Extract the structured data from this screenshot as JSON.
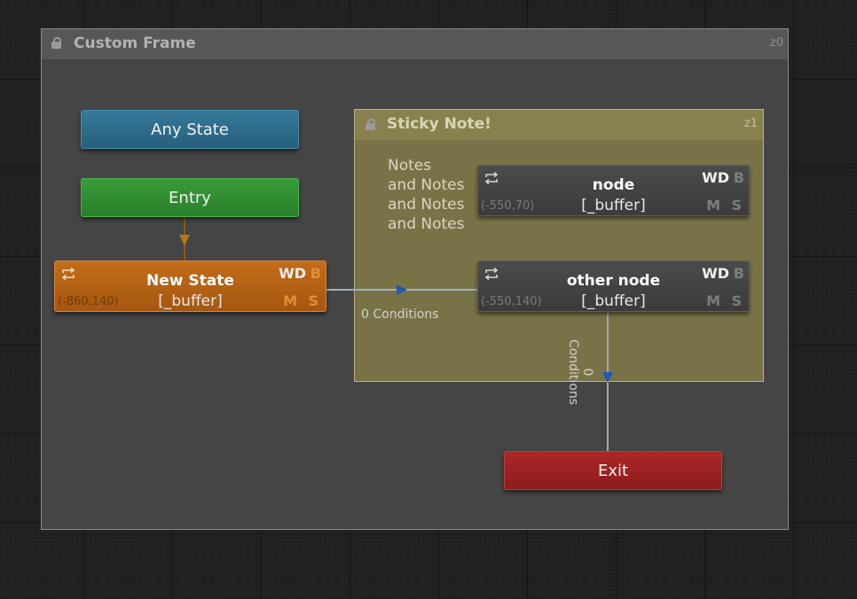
{
  "frame": {
    "title": "Custom Frame",
    "z_label": "z0"
  },
  "sticky_note": {
    "title": "Sticky Note!",
    "z_label": "z1",
    "text_lines": [
      "Notes",
      "and Notes",
      "and Notes",
      "and Notes"
    ]
  },
  "nodes": {
    "any_state": {
      "label": "Any State",
      "color": "#2c6b8a"
    },
    "entry": {
      "label": "Entry",
      "color": "#2f8d2f"
    },
    "exit": {
      "label": "Exit",
      "color": "#9c2323"
    },
    "new_state": {
      "name": "New State",
      "motion": "[_buffer]",
      "coord": "(-860,140)",
      "wd": "WD",
      "b": "B",
      "m": "M",
      "s": "S",
      "color": "#b8651a"
    },
    "node": {
      "name": "node",
      "motion": "[_buffer]",
      "coord": "(-550,70)",
      "wd": "WD",
      "b": "B",
      "m": "M",
      "s": "S"
    },
    "other_node": {
      "name": "other node",
      "motion": "[_buffer]",
      "coord": "(-550,140)",
      "wd": "WD",
      "b": "B",
      "m": "M",
      "s": "S"
    }
  },
  "transitions": {
    "new_state_to_other_node": "0 Conditions",
    "other_node_to_exit": "0 Conditions"
  },
  "colors": {
    "transition_arrow": "#2456b5",
    "entry_arrow": "#b9761e"
  },
  "icons": [
    "lock-icon",
    "loop-icon"
  ]
}
